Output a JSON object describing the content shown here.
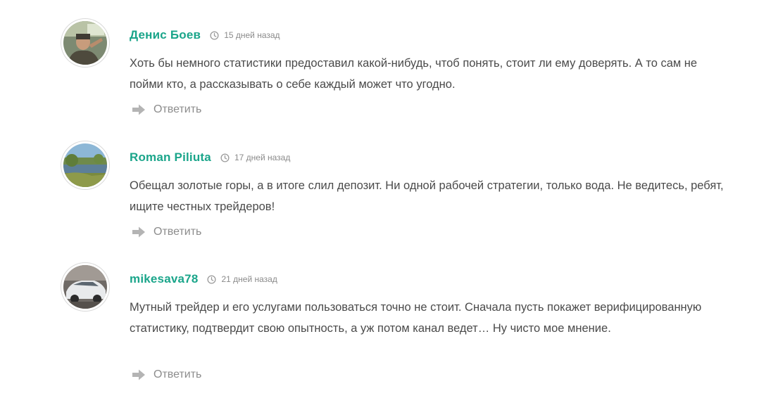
{
  "comments": [
    {
      "author": "Денис Боев",
      "date": "15 дней назад",
      "text": "Хоть бы немного статистики предоставил какой-нибудь, чтоб понять, стоит ли ему доверять. А то сам не пойми кто, а рассказывать о себе каждый может что угодно.",
      "reply_label": "Ответить"
    },
    {
      "author": "Roman Piliuta",
      "date": "17 дней назад",
      "text": "Обещал золотые горы, а в итоге слил депозит. Ни одной рабочей стратегии, только вода. Не ведитесь, ребят, ищите честных трейдеров!",
      "reply_label": "Ответить"
    },
    {
      "author": "mikesava78",
      "date": "21 дней назад",
      "text": "Мутный трейдер и его услугами пользоваться точно не стоит. Сначала пусть покажет верифицированную статистику, подтвердит свою опытность, а уж потом канал ведет… Ну чисто мое мнение.",
      "reply_label": "Ответить"
    }
  ],
  "icons": {
    "clock": "clock-icon",
    "reply": "reply-arrow-icon"
  },
  "colors": {
    "author": "#1aa58a",
    "date": "#8a8a8a",
    "text": "#4a4a4a",
    "reply": "#8c8c8c"
  }
}
